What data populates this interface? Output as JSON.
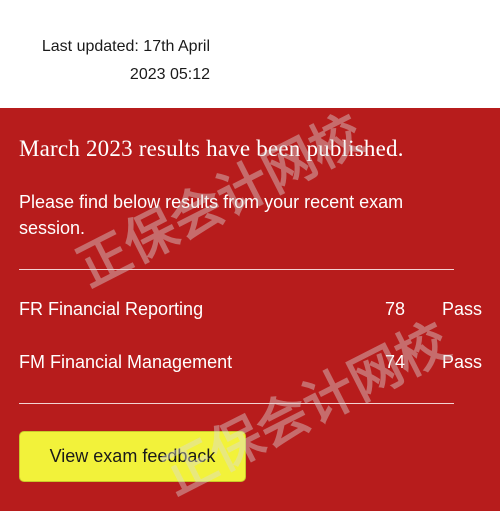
{
  "header": {
    "last_updated_line1": "Last updated: 17th April",
    "last_updated_line2": "2023 05:12"
  },
  "notice": {
    "headline": "March 2023 results have been published.",
    "intro": "Please find below results from your recent exam session."
  },
  "results": [
    {
      "subject": "FR Financial Reporting",
      "score": "78",
      "status": "Pass"
    },
    {
      "subject": "FM Financial Management",
      "score": "74",
      "status": "Pass"
    }
  ],
  "actions": {
    "feedback_label": "View exam feedback"
  },
  "watermark": {
    "text": "正保会计网校"
  },
  "colors": {
    "panel_background": "#b71c1c",
    "button_background": "#f2f23a",
    "text_on_panel": "#ffffff"
  }
}
